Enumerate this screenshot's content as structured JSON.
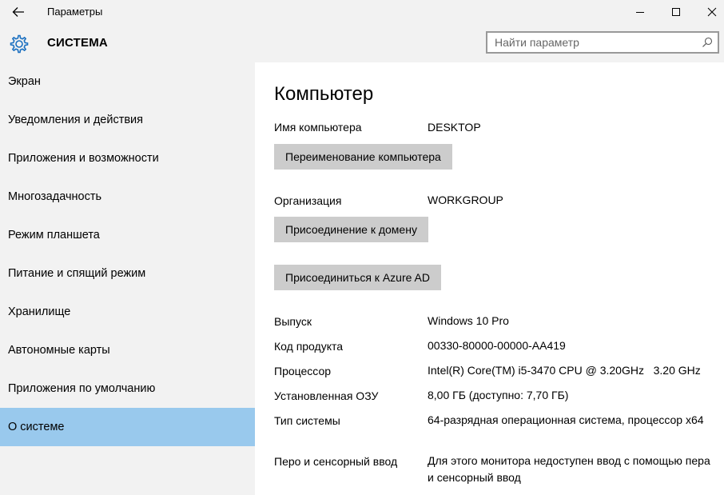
{
  "window": {
    "title": "Параметры",
    "back_icon": "back-arrow-icon",
    "controls": [
      "minimize-icon",
      "maximize-icon",
      "close-icon"
    ]
  },
  "header": {
    "icon": "gear-icon",
    "title": "СИСТЕМА",
    "search": {
      "placeholder": "Найти параметр",
      "value": "",
      "icon": "search-icon"
    }
  },
  "sidebar": {
    "items": [
      {
        "label": "Экран"
      },
      {
        "label": "Уведомления и действия"
      },
      {
        "label": "Приложения и возможности"
      },
      {
        "label": "Многозадачность"
      },
      {
        "label": "Режим планшета"
      },
      {
        "label": "Питание и спящий режим"
      },
      {
        "label": "Хранилище"
      },
      {
        "label": "Автономные карты"
      },
      {
        "label": "Приложения по умолчанию"
      },
      {
        "label": "О системе",
        "active": true
      }
    ],
    "active_color": "#99c9ed"
  },
  "main": {
    "title": "Компьютер",
    "computer_name": {
      "label": "Имя компьютера",
      "value": "DESKTOP"
    },
    "rename_button": "Переименование компьютера",
    "organization": {
      "label": "Организация",
      "value": "WORKGROUP"
    },
    "join_domain_button": "Присоединение к домену",
    "join_azure_button": "Присоединиться к Azure AD",
    "specs": [
      {
        "label": "Выпуск",
        "value": "Windows 10 Pro"
      },
      {
        "label": "Код продукта",
        "value": "00330-80000-00000-AA419"
      },
      {
        "label": "Процессор",
        "value": "Intel(R) Core(TM) i5-3470 CPU @ 3.20GHz   3.20 GHz"
      },
      {
        "label": "Установленная ОЗУ",
        "value": "8,00 ГБ (доступно: 7,70 ГБ)"
      },
      {
        "label": "Тип системы",
        "value": "64-разрядная операционная система, процессор x64"
      },
      {
        "label": "Перо и сенсорный ввод",
        "value": "Для этого монитора недоступен ввод с помощью пера и сенсорный ввод"
      }
    ]
  }
}
